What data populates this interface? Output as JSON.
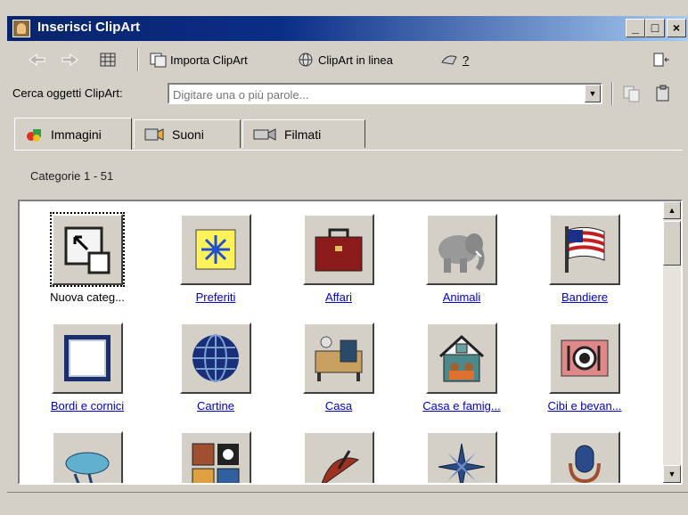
{
  "window": {
    "title": "Inserisci ClipArt",
    "controls": {
      "minimize": "_",
      "maximize": "□",
      "close": "×"
    }
  },
  "toolbar": {
    "back_icon": "arrow-left-icon",
    "forward_icon": "arrow-right-icon",
    "grid_icon": "grid-icon",
    "import_label": "Importa ClipArt",
    "online_label": "ClipArt in linea",
    "help_label": "?"
  },
  "search": {
    "label": "Cerca oggetti ClipArt:",
    "placeholder": "Digitare una o più parole..."
  },
  "tabs": [
    {
      "label": "Immagini",
      "active": true
    },
    {
      "label": "Suoni",
      "active": false
    },
    {
      "label": "Filmati",
      "active": false
    }
  ],
  "category_header": "Categorie 1 - 51",
  "categories": [
    {
      "label": "Nuova categ...",
      "icon": "new-category-icon",
      "selected": true
    },
    {
      "label": "Preferiti",
      "icon": "star-icon"
    },
    {
      "label": "Affari",
      "icon": "briefcase-icon"
    },
    {
      "label": "Animali",
      "icon": "elephant-icon"
    },
    {
      "label": "Bandiere",
      "icon": "flag-icon"
    },
    {
      "label": "Bordi e cornici",
      "icon": "frame-icon"
    },
    {
      "label": "Cartine",
      "icon": "globe-icon"
    },
    {
      "label": "Casa",
      "icon": "furniture-icon"
    },
    {
      "label": "Casa e famig...",
      "icon": "house-family-icon"
    },
    {
      "label": "Cibi e bevan...",
      "icon": "plate-icon"
    },
    {
      "label": "",
      "icon": "weather-icon"
    },
    {
      "label": "",
      "icon": "photos-icon"
    },
    {
      "label": "",
      "icon": "satellite-dish-icon"
    },
    {
      "label": "",
      "icon": "compass-icon"
    },
    {
      "label": "",
      "icon": "microphone-icon"
    }
  ],
  "colors": {
    "title_start": "#08246b",
    "title_end": "#a6caf0",
    "link": "#0000c0",
    "face": "#d4d0c8"
  }
}
